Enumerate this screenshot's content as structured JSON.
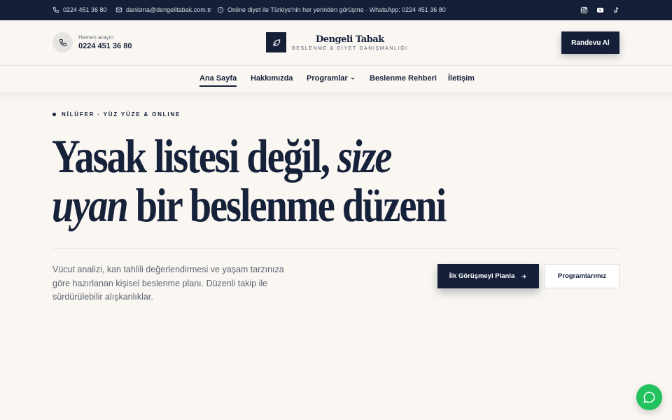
{
  "topbar": {
    "phone": "0224 451 36 80",
    "email": "danisma@dengelitabak.com.tr",
    "notice": "Online diyet ile Türkiye'nin her yerinden görüşme · WhatsApp: 0224 451 36 80",
    "social": [
      "instagram-icon",
      "youtube-icon",
      "tiktok-icon"
    ]
  },
  "header": {
    "call_label": "Hemen arayın",
    "call_number": "0224 451 36 80",
    "brand_name": "Dengeli Tabak",
    "brand_tagline": "BESLENME & DİYET DANIŞMANLIĞI",
    "cta_label": "Randevu Al"
  },
  "nav": {
    "items": [
      {
        "label": "Ana Sayfa",
        "active": true
      },
      {
        "label": "Hakkımızda"
      },
      {
        "label": "Programlar",
        "has_dropdown": true
      },
      {
        "label": "Beslenme Rehberi"
      },
      {
        "label": "İletişim"
      }
    ]
  },
  "hero": {
    "eyebrow": "NİLÜFER · YÜZ YÜZE & ONLINE",
    "headline_1": "Yasak listesi değil, ",
    "headline_1_em": "size",
    "headline_2_em": "uyan",
    "headline_2": " bir beslenme düzeni",
    "lead": "Vücut analizi, kan tahlili değerlendirmesi ve yaşam tarzınıza göre hazırlanan kişisel beslenme planı. Düzenli takip ile sürdürülebilir alışkanlıklar.",
    "primary_cta": "İlk Görüşmeyi Planla",
    "secondary_cta": "Programlarımız"
  },
  "colors": {
    "navy": "#152038",
    "background": "#faf7f2",
    "whatsapp": "#22c35e"
  }
}
